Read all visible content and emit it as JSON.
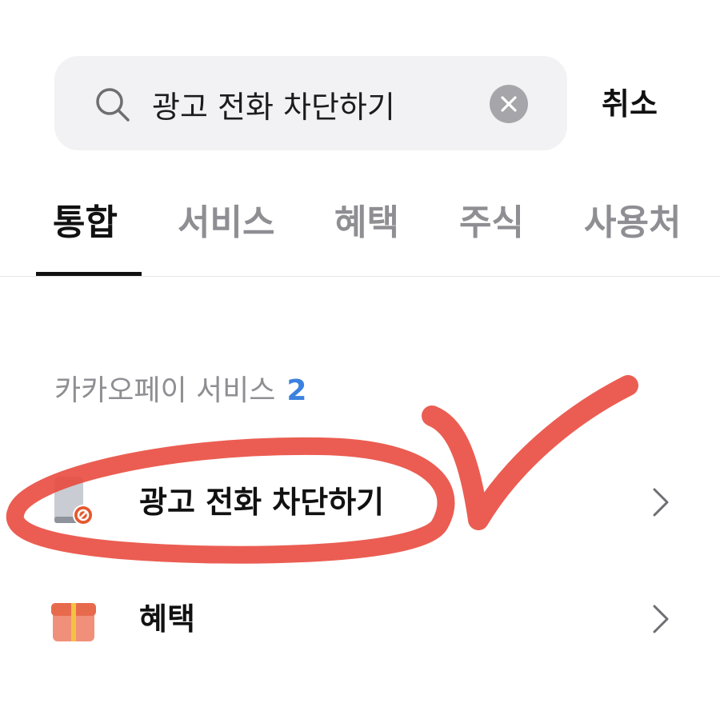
{
  "search": {
    "query": "광고 전화 차단하기",
    "cancel_label": "취소"
  },
  "tabs": [
    {
      "label": "통합",
      "active": true
    },
    {
      "label": "서비스",
      "active": false
    },
    {
      "label": "혜택",
      "active": false
    },
    {
      "label": "주식",
      "active": false
    },
    {
      "label": "사용처",
      "active": false
    }
  ],
  "section": {
    "title": "카카오페이 서비스",
    "count": "2",
    "items": [
      {
        "label": "광고 전화 차단하기",
        "icon": "phone-block-icon"
      },
      {
        "label": "혜택",
        "icon": "gift-icon"
      }
    ]
  },
  "colors": {
    "accent_count": "#3b82e0",
    "annotation_red": "#e8473a",
    "search_bg": "#f2f2f4"
  }
}
